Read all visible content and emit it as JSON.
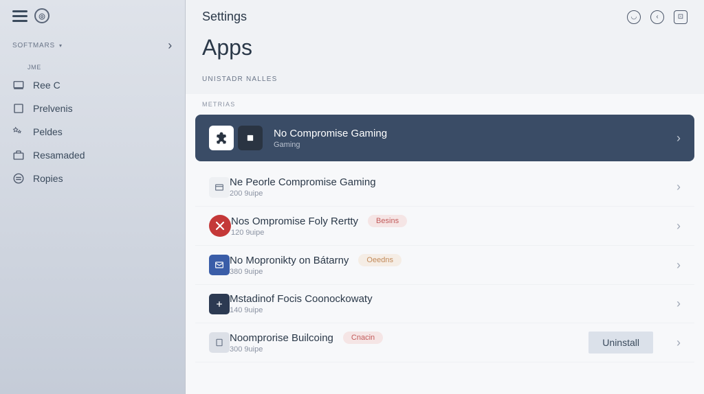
{
  "sidebar": {
    "section_label": "SOFTMARS",
    "tiny_label": "JME",
    "items": [
      {
        "label": "Ree C"
      },
      {
        "label": "Prelvenis"
      },
      {
        "label": "Peldes"
      },
      {
        "label": "Resamaded"
      },
      {
        "label": "Ropies"
      }
    ]
  },
  "header": {
    "title": "Settings"
  },
  "page": {
    "title": "Apps",
    "subsection": "UNISTADR NALLES",
    "category": "METRIAS"
  },
  "apps": [
    {
      "name": "No Compromise Gaming",
      "sub": "Gaming"
    },
    {
      "name": "Ne Peorle Compromise Gaming",
      "size": "200 9uipe"
    },
    {
      "name": "Nos Ompromise Foly Rertty",
      "size": "120 9uipe",
      "badge": "Besins"
    },
    {
      "name": "No Mopronikty on Bátarny",
      "size": "380 9uipe",
      "badge": "Oeedns"
    },
    {
      "name": "Mstadinof Focis Coonockowaty",
      "size": "140 9uipe"
    },
    {
      "name": "Noomprorise Builcoing",
      "size": "300 9uipe",
      "badge": "Cnacin"
    }
  ],
  "actions": {
    "uninstall": "Uninstall"
  }
}
